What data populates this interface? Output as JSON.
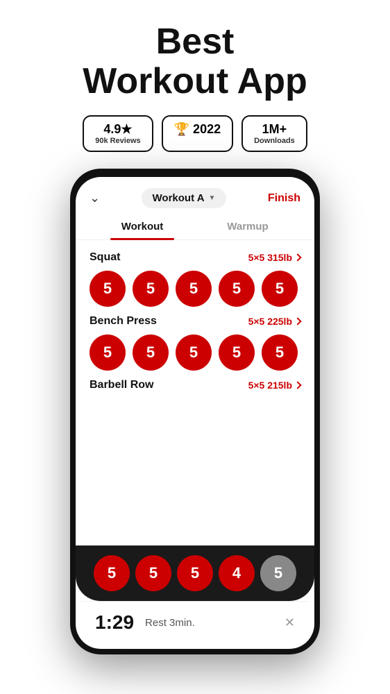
{
  "header": {
    "title": "Best\nWorkout App"
  },
  "badges": [
    {
      "id": "rating",
      "main": "4.9★",
      "sub": "90k Reviews"
    },
    {
      "id": "award",
      "main": "🏆 2022",
      "sub": ""
    },
    {
      "id": "downloads",
      "main": "1M+",
      "sub": "Downloads"
    }
  ],
  "app": {
    "workout_name": "Workout A",
    "finish_label": "Finish",
    "tabs": [
      {
        "id": "workout",
        "label": "Workout",
        "active": true
      },
      {
        "id": "warmup",
        "label": "Warmup",
        "active": false
      }
    ],
    "exercises": [
      {
        "id": "squat",
        "name": "Squat",
        "sets_label": "5×5 315lb",
        "sets": [
          {
            "reps": "5",
            "done": true
          },
          {
            "reps": "5",
            "done": true
          },
          {
            "reps": "5",
            "done": true
          },
          {
            "reps": "5",
            "done": true
          },
          {
            "reps": "5",
            "done": true
          }
        ]
      },
      {
        "id": "bench_press",
        "name": "Bench Press",
        "sets_label": "5×5 225lb",
        "sets": [
          {
            "reps": "5",
            "done": true
          },
          {
            "reps": "5",
            "done": true
          },
          {
            "reps": "5",
            "done": true
          },
          {
            "reps": "5",
            "done": true
          },
          {
            "reps": "5",
            "done": true
          }
        ]
      },
      {
        "id": "barbell_row",
        "name": "Barbell Row",
        "sets_label": "5×5 215lb",
        "sets": [
          {
            "reps": "5",
            "done": true
          },
          {
            "reps": "5",
            "done": true
          },
          {
            "reps": "5",
            "done": true
          },
          {
            "reps": "4",
            "done": true
          },
          {
            "reps": "5",
            "done": false
          }
        ]
      }
    ],
    "rest_timer": {
      "time": "1:29",
      "label": "Rest 3min."
    }
  }
}
